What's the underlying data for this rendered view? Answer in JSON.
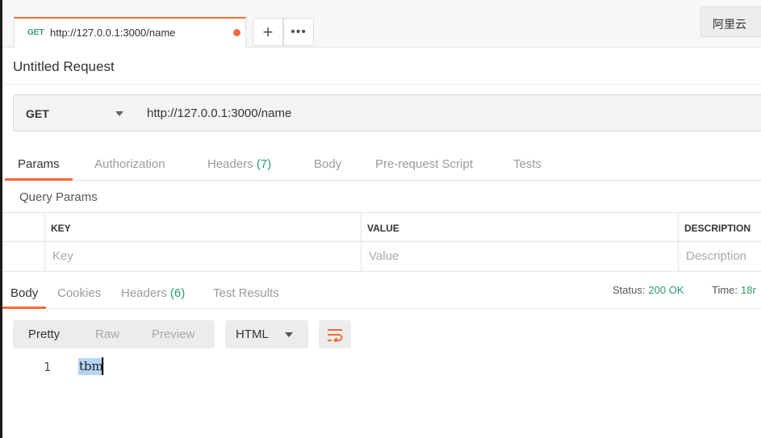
{
  "tab": {
    "method": "GET",
    "url": "http://127.0.0.1:3000/name",
    "unsaved_dot_color": "#f26b3a"
  },
  "toolbar": {
    "add_label": "+",
    "more_label": "•••",
    "environment_label": "阿里云"
  },
  "request": {
    "title": "Untitled Request",
    "method": "GET",
    "url": "http://127.0.0.1:3000/name"
  },
  "request_tabs": {
    "params": "Params",
    "authorization": "Authorization",
    "headers": "Headers",
    "headers_count": "(7)",
    "body": "Body",
    "prerequest": "Pre-request Script",
    "tests": "Tests"
  },
  "query_params": {
    "label": "Query Params",
    "columns": [
      "KEY",
      "VALUE",
      "DESCRIPTION"
    ],
    "placeholders": [
      "Key",
      "Value",
      "Description"
    ]
  },
  "response_tabs": {
    "body": "Body",
    "cookies": "Cookies",
    "headers": "Headers",
    "headers_count": "(6)",
    "test_results": "Test Results"
  },
  "response_status": {
    "status_label": "Status:",
    "status_value": "200 OK",
    "time_label": "Time:",
    "time_value": "18r"
  },
  "view": {
    "pretty": "Pretty",
    "raw": "Raw",
    "preview": "Preview",
    "format": "HTML"
  },
  "code": {
    "line_number": "1",
    "text": "tbm"
  },
  "colors": {
    "accent": "#f26b3a",
    "success": "#2b9a6b",
    "selection": "#b6d3f2"
  },
  "icons": [
    "plus-icon",
    "more-icon",
    "chevron-down-icon",
    "wrap-lines-icon"
  ]
}
